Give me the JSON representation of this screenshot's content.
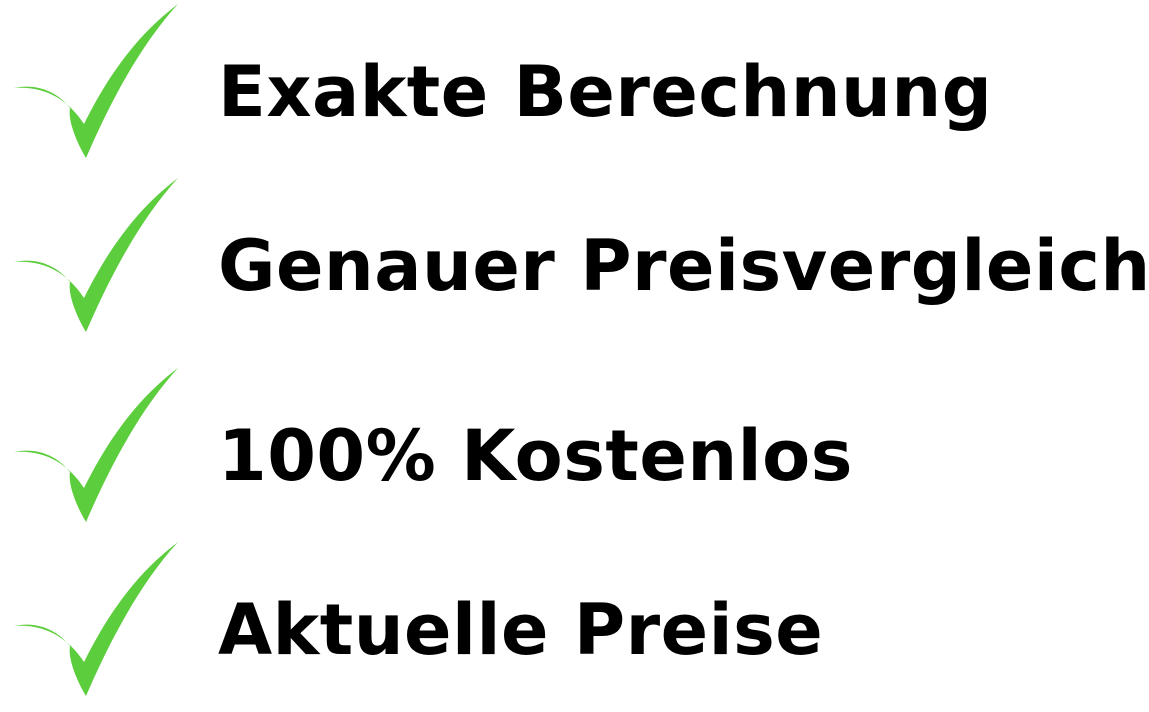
{
  "colors": {
    "check": "#5ccd3c",
    "text": "#000000",
    "background": "#ffffff"
  },
  "features": [
    {
      "label": "Exakte Berechnung",
      "icon": "checkmark-icon"
    },
    {
      "label": "Genauer Preisvergleich",
      "icon": "checkmark-icon"
    },
    {
      "label": "100% Kostenlos",
      "icon": "checkmark-icon"
    },
    {
      "label": "Aktuelle Preise",
      "icon": "checkmark-icon"
    }
  ]
}
